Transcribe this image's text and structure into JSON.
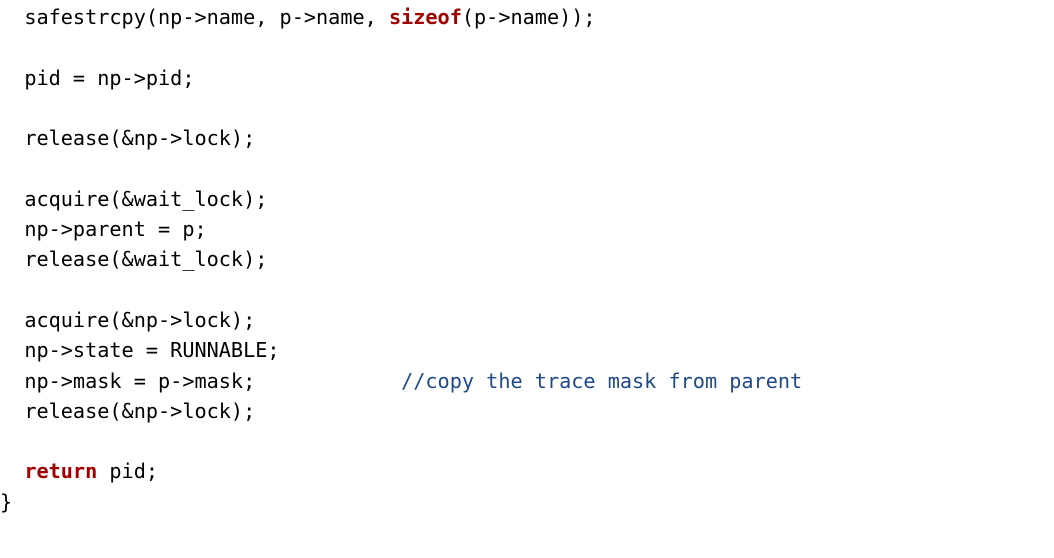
{
  "indent": "  ",
  "lines": [
    {
      "segments": [
        {
          "cls": "tok",
          "text": "safestrcpy(np->name, p->name, "
        },
        {
          "cls": "kw",
          "text": "sizeof"
        },
        {
          "cls": "tok",
          "text": "(p->name));"
        }
      ],
      "indent": 1
    },
    {
      "segments": [
        {
          "cls": "tok",
          "text": ""
        }
      ],
      "indent": 0
    },
    {
      "segments": [
        {
          "cls": "tok",
          "text": "pid = np->pid;"
        }
      ],
      "indent": 1
    },
    {
      "segments": [
        {
          "cls": "tok",
          "text": ""
        }
      ],
      "indent": 0
    },
    {
      "segments": [
        {
          "cls": "tok",
          "text": "release(&np->lock);"
        }
      ],
      "indent": 1
    },
    {
      "segments": [
        {
          "cls": "tok",
          "text": ""
        }
      ],
      "indent": 0
    },
    {
      "segments": [
        {
          "cls": "tok",
          "text": "acquire(&wait_lock);"
        }
      ],
      "indent": 1
    },
    {
      "segments": [
        {
          "cls": "tok",
          "text": "np->parent = p;"
        }
      ],
      "indent": 1
    },
    {
      "segments": [
        {
          "cls": "tok",
          "text": "release(&wait_lock);"
        }
      ],
      "indent": 1
    },
    {
      "segments": [
        {
          "cls": "tok",
          "text": ""
        }
      ],
      "indent": 0
    },
    {
      "segments": [
        {
          "cls": "tok",
          "text": "acquire(&np->lock);"
        }
      ],
      "indent": 1
    },
    {
      "segments": [
        {
          "cls": "tok",
          "text": "np->state = RUNNABLE;"
        }
      ],
      "indent": 1
    },
    {
      "segments": [
        {
          "cls": "tok",
          "text": "np->mask = p->mask;            "
        },
        {
          "cls": "cm",
          "text": "//copy the trace mask from parent"
        }
      ],
      "indent": 1
    },
    {
      "segments": [
        {
          "cls": "tok",
          "text": "release(&np->lock);"
        }
      ],
      "indent": 1
    },
    {
      "segments": [
        {
          "cls": "tok",
          "text": ""
        }
      ],
      "indent": 0
    },
    {
      "segments": [
        {
          "cls": "kw",
          "text": "return"
        },
        {
          "cls": "tok",
          "text": " pid;"
        }
      ],
      "indent": 1
    },
    {
      "segments": [
        {
          "cls": "tok",
          "text": "}"
        }
      ],
      "indent": 0
    }
  ]
}
